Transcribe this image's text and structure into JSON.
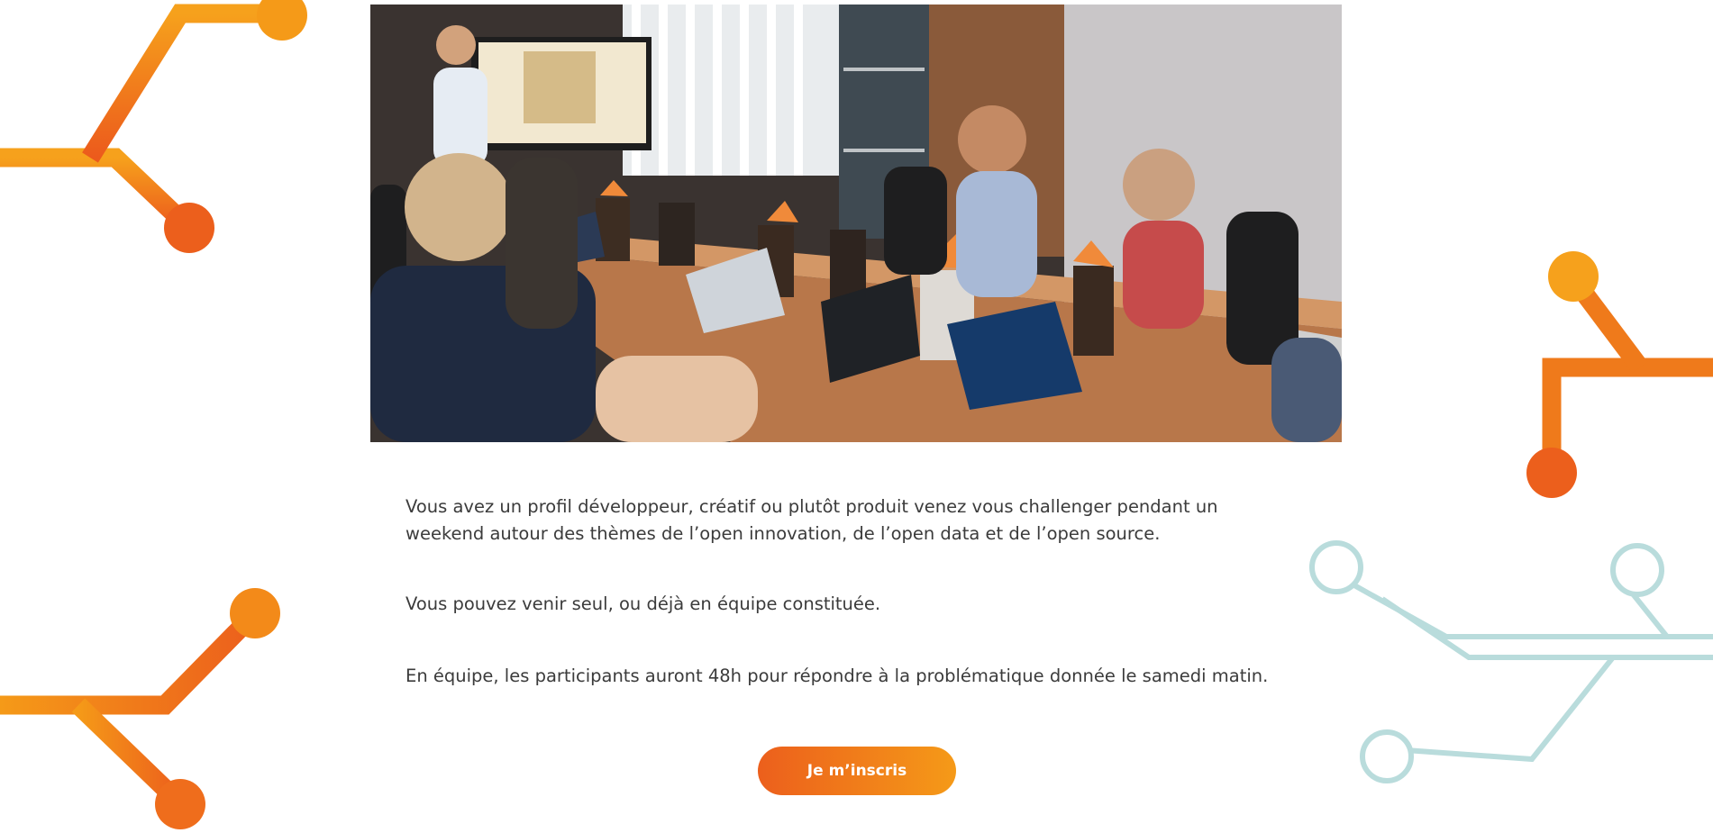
{
  "hero_image": {
    "description_icon": "meeting-photo"
  },
  "intro": {
    "paragraph_1": "Vous avez un profil développeur, créatif ou plutôt produit venez vous challenger pendant un weekend autour des thèmes de l’open innovation, de l’open data et de l’open source.",
    "paragraph_2": "Vous pouvez venir seul, ou déjà en équipe constituée.",
    "paragraph_3": "En équipe, les participants auront 48h pour répondre à la problématique donnée le samedi matin."
  },
  "cta": {
    "label": "Je m’inscris"
  },
  "colors": {
    "accent_start": "#ec5f1c",
    "accent_end": "#f59a18",
    "circuit_teal": "#b9dcdc",
    "text": "#3b3b3b"
  }
}
